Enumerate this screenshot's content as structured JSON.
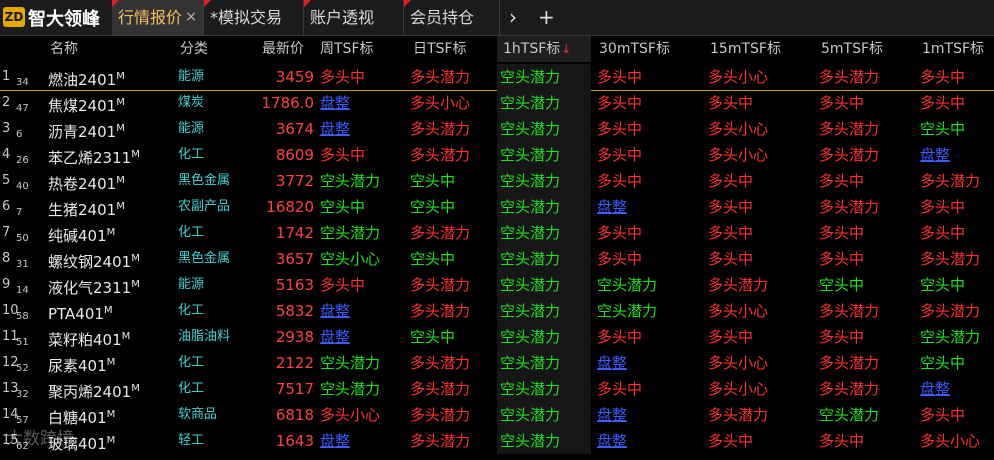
{
  "app": {
    "logo_badge": "ZD",
    "logo_text": "智大领峰"
  },
  "tabs": [
    {
      "label": "行情报价",
      "close": "×"
    },
    {
      "label": "*模拟交易"
    },
    {
      "label": "账户透视"
    },
    {
      "label": "会员持仓"
    }
  ],
  "toolbar": {
    "next_icon": "›",
    "add_icon": "+"
  },
  "columns": [
    "名称",
    "分类",
    "最新价",
    "周TSF标",
    "日TSF标",
    "1hTSF标",
    "30mTSF标",
    "15mTSF标",
    "5mTSF标",
    "1mTSF标"
  ],
  "sort_indicator": "↓",
  "rows": [
    {
      "idx": "1",
      "sub": "34",
      "name": "燃油2401",
      "sup": "M",
      "cat": "能源",
      "price": "3459",
      "signals": [
        [
          "多头中",
          "red"
        ],
        [
          "多头潜力",
          "red"
        ],
        [
          "空头潜力",
          "green"
        ],
        [
          "多头中",
          "red"
        ],
        [
          "多头小心",
          "red"
        ],
        [
          "多头潜力",
          "red"
        ],
        [
          "多头中",
          "red"
        ]
      ]
    },
    {
      "idx": "2",
      "sub": "47",
      "name": "焦煤2401",
      "sup": "M",
      "cat": "煤炭",
      "price": "1786.0",
      "signals": [
        [
          "盘整",
          "blue"
        ],
        [
          "多头小心",
          "red"
        ],
        [
          "空头潜力",
          "green"
        ],
        [
          "多头中",
          "red"
        ],
        [
          "多头中",
          "red"
        ],
        [
          "多头中",
          "red"
        ],
        [
          "多头中",
          "red"
        ]
      ]
    },
    {
      "idx": "3",
      "sub": "6",
      "name": "沥青2401",
      "sup": "M",
      "cat": "能源",
      "price": "3674",
      "signals": [
        [
          "盘整",
          "blue"
        ],
        [
          "多头潜力",
          "red"
        ],
        [
          "空头潜力",
          "green"
        ],
        [
          "多头中",
          "red"
        ],
        [
          "多头小心",
          "red"
        ],
        [
          "多头潜力",
          "red"
        ],
        [
          "空头中",
          "green"
        ]
      ]
    },
    {
      "idx": "4",
      "sub": "26",
      "name": "苯乙烯2311",
      "sup": "M",
      "cat": "化工",
      "price": "8609",
      "signals": [
        [
          "多头中",
          "red"
        ],
        [
          "多头潜力",
          "red"
        ],
        [
          "空头潜力",
          "green"
        ],
        [
          "多头中",
          "red"
        ],
        [
          "多头小心",
          "red"
        ],
        [
          "多头潜力",
          "red"
        ],
        [
          "盘整",
          "blue"
        ]
      ]
    },
    {
      "idx": "5",
      "sub": "40",
      "name": "热卷2401",
      "sup": "M",
      "cat": "黑色金属",
      "price": "3772",
      "signals": [
        [
          "空头潜力",
          "green"
        ],
        [
          "空头中",
          "green"
        ],
        [
          "空头潜力",
          "green"
        ],
        [
          "多头中",
          "red"
        ],
        [
          "多头中",
          "red"
        ],
        [
          "多头中",
          "red"
        ],
        [
          "多头潜力",
          "red"
        ]
      ]
    },
    {
      "idx": "6",
      "sub": "7",
      "name": "生猪2401",
      "sup": "M",
      "cat": "农副产品",
      "price": "16820",
      "signals": [
        [
          "空头中",
          "green"
        ],
        [
          "空头中",
          "green"
        ],
        [
          "空头潜力",
          "green"
        ],
        [
          "盘整",
          "blue"
        ],
        [
          "多头中",
          "red"
        ],
        [
          "多头潜力",
          "red"
        ],
        [
          "多头中",
          "red"
        ]
      ]
    },
    {
      "idx": "7",
      "sub": "50",
      "name": "纯碱401",
      "sup": "M",
      "cat": "化工",
      "price": "1742",
      "signals": [
        [
          "空头潜力",
          "green"
        ],
        [
          "多头潜力",
          "red"
        ],
        [
          "空头潜力",
          "green"
        ],
        [
          "多头中",
          "red"
        ],
        [
          "多头中",
          "red"
        ],
        [
          "多头中",
          "red"
        ],
        [
          "多头中",
          "red"
        ]
      ]
    },
    {
      "idx": "8",
      "sub": "31",
      "name": "螺纹钢2401",
      "sup": "M",
      "cat": "黑色金属",
      "price": "3657",
      "signals": [
        [
          "空头小心",
          "green"
        ],
        [
          "空头中",
          "green"
        ],
        [
          "空头潜力",
          "green"
        ],
        [
          "多头中",
          "red"
        ],
        [
          "多头中",
          "red"
        ],
        [
          "多头中",
          "red"
        ],
        [
          "多头潜力",
          "red"
        ]
      ]
    },
    {
      "idx": "9",
      "sub": "14",
      "name": "液化气2311",
      "sup": "M",
      "cat": "能源",
      "price": "5163",
      "signals": [
        [
          "多头中",
          "red"
        ],
        [
          "多头潜力",
          "red"
        ],
        [
          "空头潜力",
          "green"
        ],
        [
          "空头潜力",
          "green"
        ],
        [
          "多头潜力",
          "red"
        ],
        [
          "空头中",
          "green"
        ],
        [
          "空头中",
          "green"
        ]
      ]
    },
    {
      "idx": "10",
      "sub": "58",
      "name": "PTA401",
      "sup": "M",
      "cat": "化工",
      "price": "5832",
      "signals": [
        [
          "盘整",
          "blue"
        ],
        [
          "多头潜力",
          "red"
        ],
        [
          "空头潜力",
          "green"
        ],
        [
          "空头潜力",
          "green"
        ],
        [
          "多头小心",
          "red"
        ],
        [
          "多头潜力",
          "red"
        ],
        [
          "多头潜力",
          "red"
        ]
      ]
    },
    {
      "idx": "11",
      "sub": "51",
      "name": "菜籽粕401",
      "sup": "M",
      "cat": "油脂油料",
      "price": "2938",
      "signals": [
        [
          "盘整",
          "blue"
        ],
        [
          "空头中",
          "green"
        ],
        [
          "空头潜力",
          "green"
        ],
        [
          "多头中",
          "red"
        ],
        [
          "多头中",
          "red"
        ],
        [
          "多头中",
          "red"
        ],
        [
          "空头潜力",
          "green"
        ]
      ]
    },
    {
      "idx": "12",
      "sub": "52",
      "name": "尿素401",
      "sup": "M",
      "cat": "化工",
      "price": "2122",
      "signals": [
        [
          "空头潜力",
          "green"
        ],
        [
          "多头潜力",
          "red"
        ],
        [
          "空头潜力",
          "green"
        ],
        [
          "盘整",
          "blue"
        ],
        [
          "多头小心",
          "red"
        ],
        [
          "多头潜力",
          "red"
        ],
        [
          "空头中",
          "green"
        ]
      ]
    },
    {
      "idx": "13",
      "sub": "32",
      "name": "聚丙烯2401",
      "sup": "M",
      "cat": "化工",
      "price": "7517",
      "signals": [
        [
          "空头潜力",
          "green"
        ],
        [
          "多头潜力",
          "red"
        ],
        [
          "空头潜力",
          "green"
        ],
        [
          "多头中",
          "red"
        ],
        [
          "多头小心",
          "red"
        ],
        [
          "多头潜力",
          "red"
        ],
        [
          "盘整",
          "blue"
        ]
      ]
    },
    {
      "idx": "14",
      "sub": "57",
      "name": "白糖401",
      "sup": "M",
      "cat": "软商品",
      "price": "6818",
      "signals": [
        [
          "多头小心",
          "red"
        ],
        [
          "多头潜力",
          "red"
        ],
        [
          "空头潜力",
          "green"
        ],
        [
          "盘整",
          "blue"
        ],
        [
          "多头潜力",
          "red"
        ],
        [
          "空头潜力",
          "green"
        ],
        [
          "多头中",
          "red"
        ]
      ]
    },
    {
      "idx": "15",
      "sub": "62",
      "name": "玻璃401",
      "sup": "M",
      "cat": "轻工",
      "price": "1643",
      "signals": [
        [
          "盘整",
          "blue"
        ],
        [
          "多头潜力",
          "red"
        ],
        [
          "空头潜力",
          "green"
        ],
        [
          "盘整",
          "blue"
        ],
        [
          "多头中",
          "red"
        ],
        [
          "多头中",
          "red"
        ],
        [
          "多头小心",
          "red"
        ]
      ]
    }
  ],
  "watermark": "大数跨境"
}
